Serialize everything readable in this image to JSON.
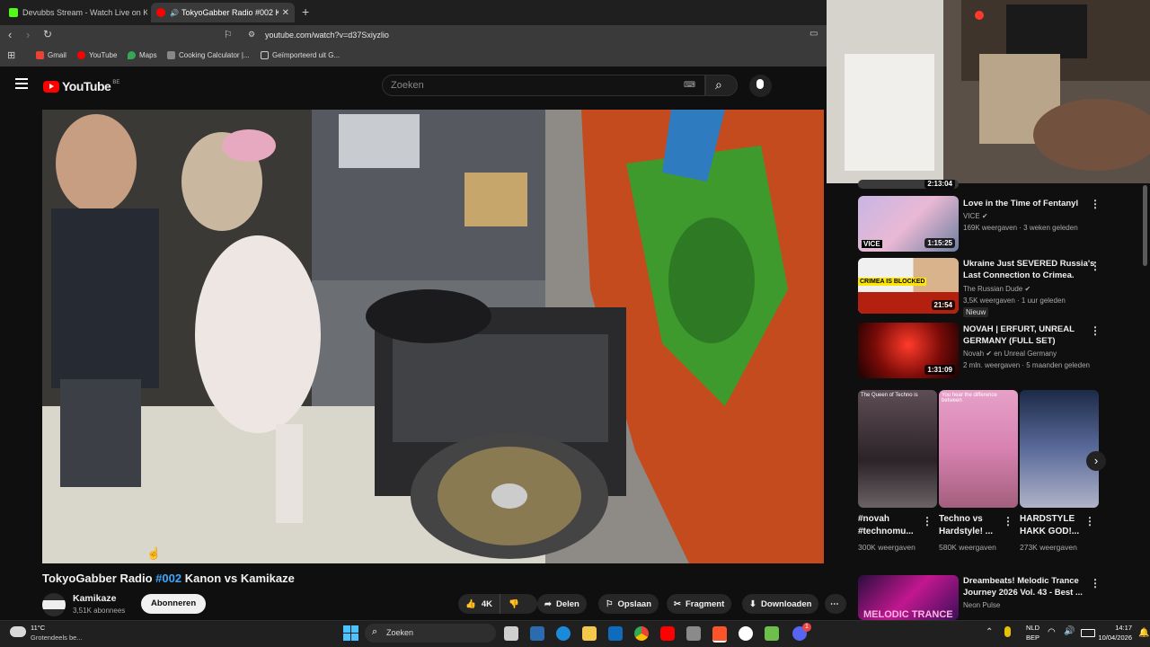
{
  "browser": {
    "tabs": [
      {
        "label": "Devubbs Stream - Watch Live on Kick",
        "active": false,
        "color": "#53fc18"
      },
      {
        "label": "TokyoGabber Radio #002 Kan",
        "active": true,
        "color": "#ff0000"
      }
    ],
    "new_tab_label": "+",
    "url": "youtube.com/watch?v=d37Sxiyzlio",
    "bookmarks": [
      {
        "label": "Gmail",
        "color": "#ea4335"
      },
      {
        "label": "YouTube",
        "color": "#ff0000"
      },
      {
        "label": "Maps",
        "color": "#34a853"
      },
      {
        "label": "Cooking Calculator |...",
        "color": "#888888"
      },
      {
        "label": "Geïmporteerd uit G...",
        "color": "#cccccc"
      }
    ]
  },
  "youtube": {
    "logo": "YouTube",
    "region": "BE",
    "search_placeholder": "Zoeken"
  },
  "video": {
    "title_prefix": "TokyoGabber Radio ",
    "title_tag": "#002",
    "title_suffix": " Kanon vs Kamikaze",
    "channel": "Kamikaze",
    "subscribers": "3,51K abonnees",
    "subscribe_label": "Abonneren",
    "likes": "4K",
    "share_label": "Delen",
    "save_label": "Opslaan",
    "clip_label": "Fragment",
    "download_label": "Downloaden"
  },
  "recommendations": [
    {
      "title": "",
      "channel": "",
      "meta": "",
      "duration": "2:13:04"
    },
    {
      "title": "Love in the Time of Fentanyl",
      "channel": "VICE",
      "meta": "169K weergaven · 3 weken geleden",
      "duration": "1:15:25",
      "thumb_text": "VICE"
    },
    {
      "title": "Ukraine Just SEVERED Russia's Last Connection to Crimea.",
      "channel": "The Russian Dude",
      "meta": "3,5K weergaven · 1 uur geleden",
      "badge": "Nieuw",
      "duration": "21:54",
      "thumb_text": "CRIMEA IS BLOCKED"
    },
    {
      "title": "NOVAH | ERFURT, UNREAL GERMANY (FULL SET)",
      "channel": "Novah",
      "channel_extra": "en Unreal Germany",
      "meta": "2 mln. weergaven · 5 maanden geleden",
      "duration": "1:31:09"
    },
    {
      "title": "Dreambeats! Melodic Trance Journey 2026 Vol. 43 - Best ...",
      "channel": "Neon Pulse",
      "meta": "",
      "duration": "",
      "thumb_text": "MELODIC TRANCE"
    }
  ],
  "shorts": [
    {
      "title": "#novah #technomu...",
      "views": "300K weergaven",
      "caption": "The Queen of Techno is"
    },
    {
      "title": "Techno vs Hardstyle! ...",
      "views": "580K weergaven",
      "caption": "You hear the difference between"
    },
    {
      "title": "HARDSTYLE HAKK GOD!...",
      "views": "273K weergaven",
      "caption": ""
    }
  ],
  "taskbar": {
    "weather_temp": "11°C",
    "weather_desc": "Grotendeels be...",
    "search_label": "Zoeken",
    "lang": "NLD",
    "lang_sub": "BEP",
    "time": "14:17",
    "date": "10/04/2026",
    "notification_count": "1"
  }
}
